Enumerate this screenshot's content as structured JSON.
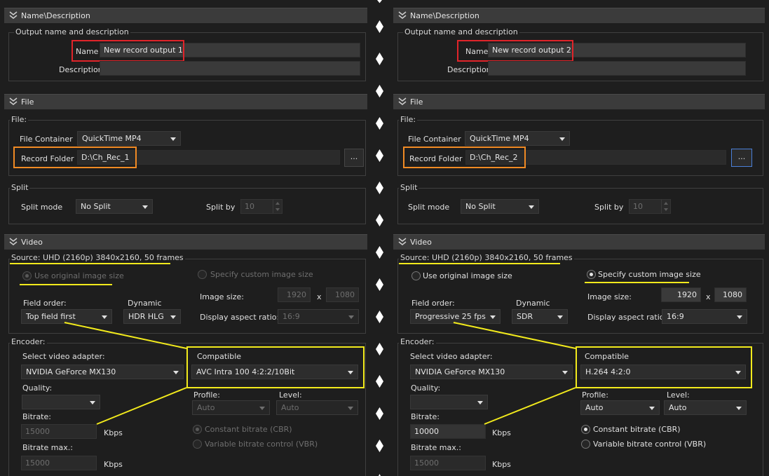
{
  "left": {
    "sections": {
      "name": "Name\\Description",
      "file": "File",
      "video": "Video"
    },
    "output_group": "Output name and description",
    "name_label": "Name",
    "name_value": "New record output 1",
    "description_label": "Description",
    "file_group": "File:",
    "file_container_label": "File Container",
    "file_container_value": "QuickTime MP4",
    "record_folder_label": "Record Folder",
    "record_folder_value": "D:\\Ch_Rec_1",
    "browse_label": "...",
    "split_group": "Split",
    "split_mode_label": "Split mode",
    "split_mode_value": "No Split",
    "split_by_label": "Split by",
    "split_by_value": "10",
    "source_text": "Source: UHD (2160p) 3840x2160, 50 frames",
    "use_original_label": "Use original image size",
    "specify_custom_label": "Specify custom image size",
    "image_size_label": "Image size:",
    "width_value": "1920",
    "x_label": "x",
    "height_value": "1080",
    "field_order_label": "Field order:",
    "field_order_value": "Top field first",
    "dynamic_label": "Dynamic",
    "dynamic_value": "HDR HLG",
    "aspect_label": "Display aspect ratio:",
    "aspect_value": "16:9",
    "encoder_group": "Encoder:",
    "adapter_label": "Select video adapter:",
    "adapter_value": "NVIDIA GeForce MX130",
    "compatible_label": "Compatible",
    "compatible_value": "AVC Intra 100 4:2:2/10Bit",
    "quality_label": "Quality:",
    "quality_value": "",
    "profile_label": "Profile:",
    "profile_value": "Auto",
    "level_label": "Level:",
    "level_value": "Auto",
    "bitrate_label": "Bitrate:",
    "bitrate_value": "15000",
    "kbps_label": "Kbps",
    "cbr_label": "Constant bitrate (CBR)",
    "vbr_label": "Variable bitrate control (VBR)",
    "bitrate_max_label": "Bitrate max.:",
    "bitrate_max_value": "15000",
    "kbps_label_2": "Kbps"
  },
  "right": {
    "sections": {
      "name": "Name\\Description",
      "file": "File",
      "video": "Video"
    },
    "output_group": "Output name and description",
    "name_label": "Name",
    "name_value": "New record output 2",
    "description_label": "Description",
    "file_group": "File:",
    "file_container_label": "File Container",
    "file_container_value": "QuickTime MP4",
    "record_folder_label": "Record Folder",
    "record_folder_value": "D:\\Ch_Rec_2",
    "browse_label": "...",
    "split_group": "Split",
    "split_mode_label": "Split mode",
    "split_mode_value": "No Split",
    "split_by_label": "Split by",
    "split_by_value": "10",
    "source_text": "Source: UHD (2160p) 3840x2160, 50 frames",
    "use_original_label": "Use original image size",
    "specify_custom_label": "Specify custom image size",
    "image_size_label": "Image size:",
    "width_value": "1920",
    "x_label": "x",
    "height_value": "1080",
    "field_order_label": "Field order:",
    "field_order_value": "Progressive 25 fps",
    "dynamic_label": "Dynamic",
    "dynamic_value": "SDR",
    "aspect_label": "Display aspect ratio:",
    "aspect_value": "16:9",
    "encoder_group": "Encoder:",
    "adapter_label": "Select video adapter:",
    "adapter_value": "NVIDIA GeForce MX130",
    "compatible_label": "Compatible",
    "compatible_value": "H.264 4:2:0",
    "quality_label": "Quality:",
    "quality_value": "",
    "profile_label": "Profile:",
    "profile_value": "Auto",
    "level_label": "Level:",
    "level_value": "Auto",
    "bitrate_label": "Bitrate:",
    "bitrate_value": "10000",
    "kbps_label": "Kbps",
    "cbr_label": "Constant bitrate (CBR)",
    "vbr_label": "Variable bitrate control (VBR)",
    "bitrate_max_label": "Bitrate max.:",
    "bitrate_max_value": "15000",
    "kbps_label_2": "Kbps"
  },
  "colors": {
    "background": "#1e1e1e",
    "section_header": "#3b3b3b",
    "highlight_red": "#e0242a",
    "highlight_orange": "#f08a24",
    "highlight_yellow": "#f2ea1c"
  },
  "icons": [
    "collapse-chevron-icon",
    "dropdown-arrow-icon",
    "spin-arrows-icon",
    "radio-icon"
  ]
}
